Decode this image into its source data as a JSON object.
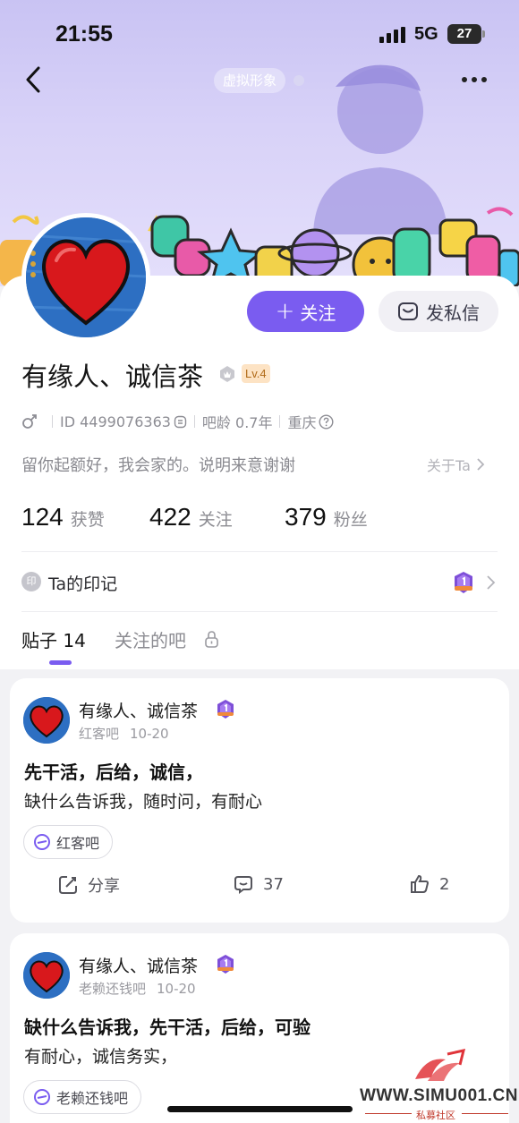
{
  "status_bar": {
    "time": "21:55",
    "network": "5G",
    "battery": "27"
  },
  "header": {
    "avatar_tag": "虚拟形象"
  },
  "profile": {
    "follow_label": "关注",
    "message_label": "发私信",
    "username": "有缘人、诚信茶",
    "level": "Lv.4",
    "id_text": "ID 4499076363",
    "tieba_age": "吧龄 0.7年",
    "location": "重庆",
    "bio": "留你起额好，我会家的。说明来意谢谢",
    "about_label": "关于Ta"
  },
  "stats": [
    {
      "value": "124",
      "label": "获赞"
    },
    {
      "value": "422",
      "label": "关注"
    },
    {
      "value": "379",
      "label": "粉丝"
    }
  ],
  "seal": {
    "icon_text": "印",
    "label": "Ta的印记"
  },
  "tabs": {
    "posts_label": "贴子",
    "posts_count": "14",
    "followed_bars_label": "关注的吧"
  },
  "posts": [
    {
      "author": "有缘人、诚信茶",
      "forum": "红客吧",
      "date": "10-20",
      "title": "先干活，后给，诚信，",
      "body": "缺什么告诉我，随时问，有耐心",
      "forum_tag": "红客吧",
      "share_label": "分享",
      "comments": "37",
      "likes": "2"
    },
    {
      "author": "有缘人、诚信茶",
      "forum": "老赖还钱吧",
      "date": "10-20",
      "title": "缺什么告诉我，先干活，后给，可验",
      "body": "有耐心，诚信务实，",
      "forum_tag": "老赖还钱吧"
    }
  ],
  "watermark": {
    "site": "WWW.SIMU001.CN",
    "sub": "私募社区"
  },
  "colors": {
    "accent": "#7a5cf0",
    "banner": "#d2ccf6",
    "level_badge_bg": "#fde3c4"
  }
}
